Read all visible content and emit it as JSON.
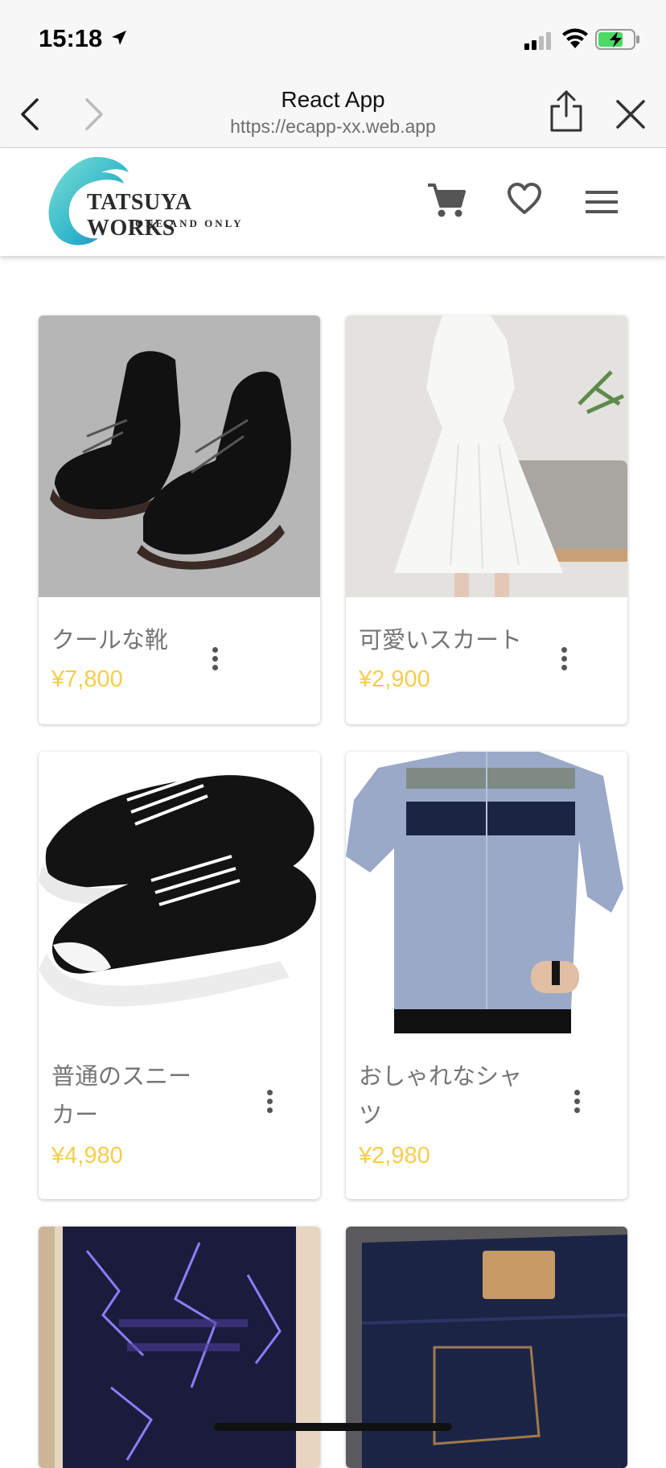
{
  "status": {
    "time": "15:18"
  },
  "browser": {
    "title": "React App",
    "url": "https://ecapp-xx.web.app"
  },
  "brand": {
    "name": "TATSUYA WORKS",
    "tagline": "ONE AND ONLY"
  },
  "header_icons": [
    "cart-icon",
    "heart-icon",
    "menu-icon"
  ],
  "colors": {
    "price": "#f6cd4c",
    "name": "#757575",
    "brand_teal": "#2fb5c9"
  },
  "products": [
    {
      "name": "クールな靴",
      "price": "¥7,800",
      "image": "black-leather-boots"
    },
    {
      "name": "可愛いスカート",
      "price": "¥2,900",
      "image": "white-dress"
    },
    {
      "name_line1": "普通のスニー",
      "name_line2": "カー",
      "price": "¥4,980",
      "image": "black-sneakers"
    },
    {
      "name_line1": "おしゃれなシャ",
      "name_line2": "ツ",
      "price": "¥2,980",
      "image": "blue-striped-shirt"
    },
    {
      "image": "lightning-tshirt"
    },
    {
      "image": "denim-jeans"
    }
  ]
}
